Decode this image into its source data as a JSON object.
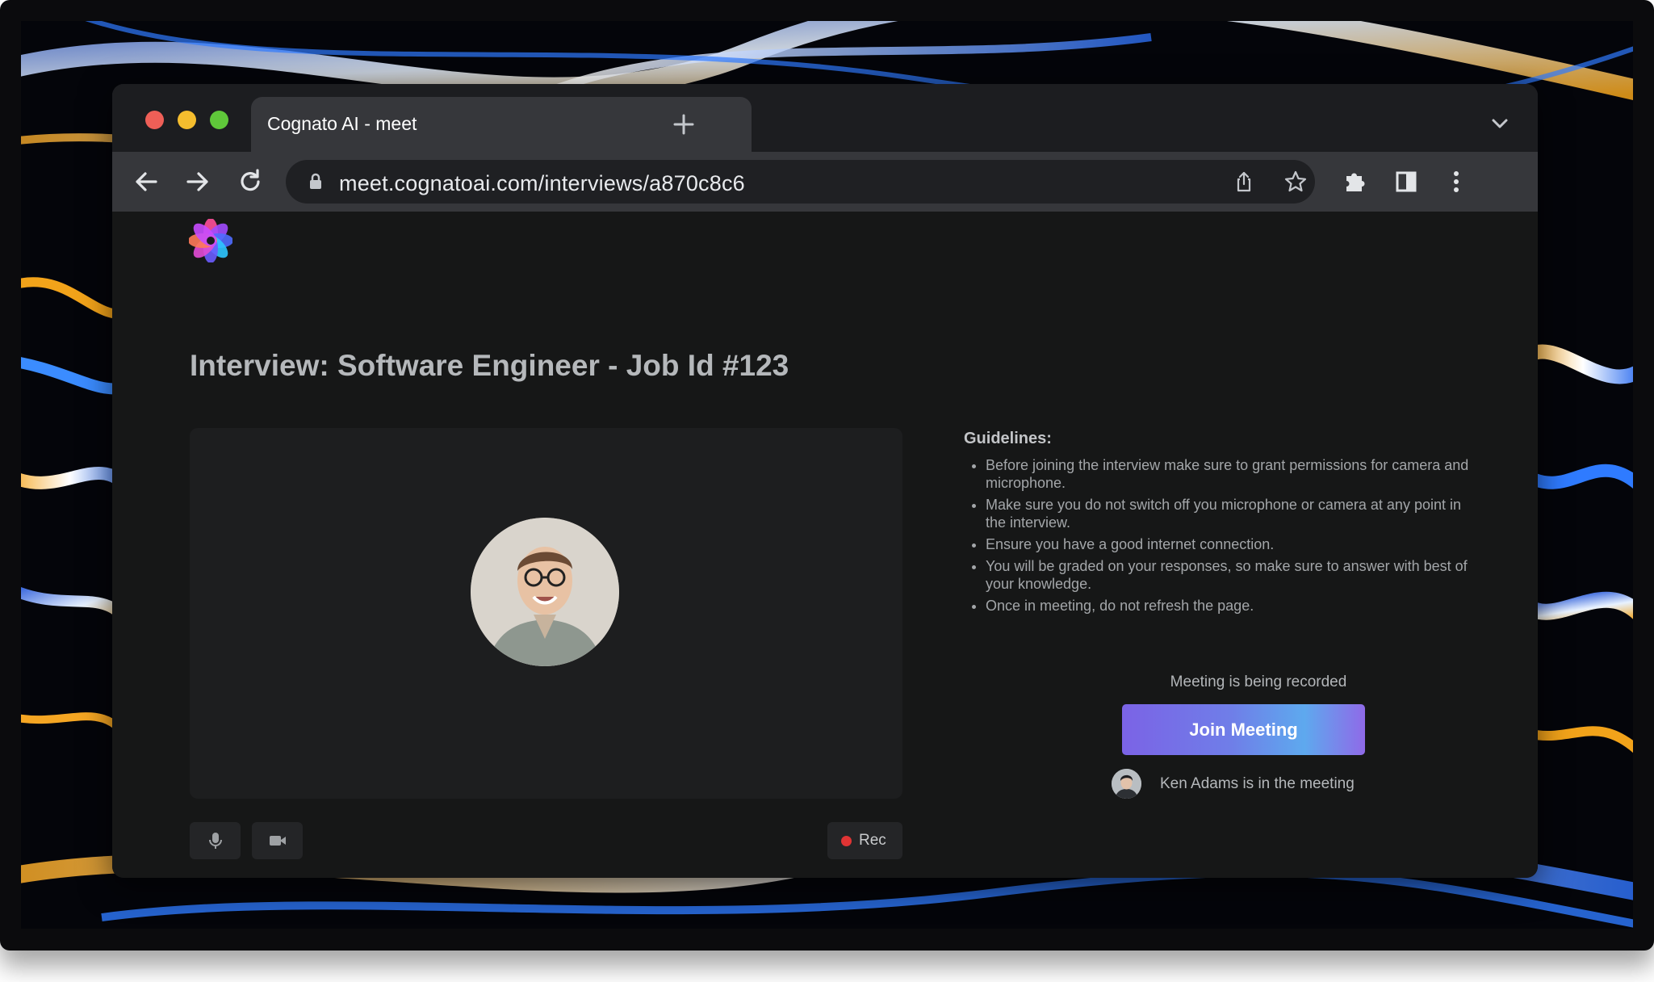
{
  "browser": {
    "tab_title": "Cognato AI - meet",
    "url": "meet.cognatoai.com/interviews/a870c8c6"
  },
  "page": {
    "title": "Interview: Software Engineer - Job Id #123",
    "guidelines_title": "Guidelines:",
    "guidelines": [
      "Before joining the interview make sure to grant permissions for camera and microphone.",
      "Make sure you do not switch off you microphone or camera at any point in the interview.",
      "Ensure you have a good internet connection.",
      "You will be graded on your responses, so make sure to answer with best of your knowledge.",
      "Once in meeting, do not refresh the page."
    ],
    "recording_note": "Meeting is being recorded",
    "join_label": "Join Meeting",
    "in_meeting_text": "Ken Adams is in the meeting",
    "rec_label": "Rec"
  },
  "icons": {
    "back": "arrow-left-icon",
    "forward": "arrow-right-icon",
    "reload": "reload-icon",
    "lock": "lock-icon",
    "share": "share-icon",
    "bookmark": "star-icon",
    "extensions": "puzzle-icon",
    "side_panel": "side-panel-icon",
    "menu": "kebab-menu-icon",
    "mic": "microphone-icon",
    "camera": "video-camera-icon"
  },
  "colors": {
    "page_bg": "#161717",
    "join_gradient_start": "#7b63e6",
    "join_gradient_end": "#5ea9ee",
    "rec_dot": "#e03434"
  }
}
